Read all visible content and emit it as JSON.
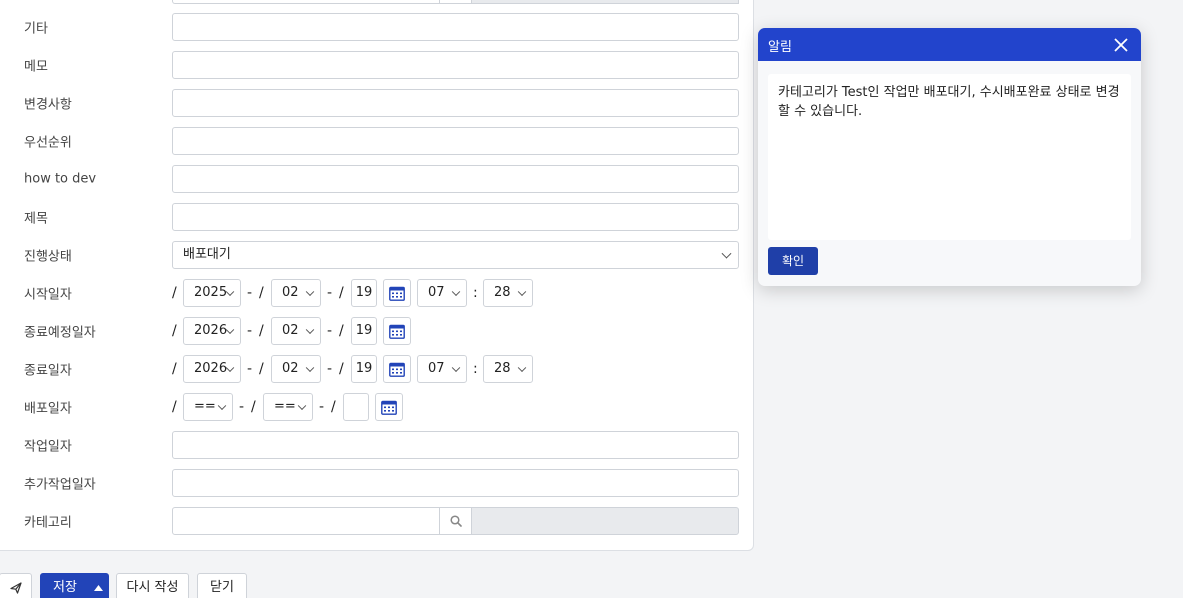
{
  "form": {
    "rows": [
      {
        "label": "기타"
      },
      {
        "label": "메모"
      },
      {
        "label": "변경사항"
      },
      {
        "label": "우선순위"
      },
      {
        "label": "how to dev"
      },
      {
        "label": "제목"
      }
    ],
    "status": {
      "label": "진행상태",
      "value": "배포대기"
    },
    "start_date": {
      "label": "시작일자",
      "year": "2025",
      "month": "02",
      "day": "19",
      "hour": "07",
      "minute": "28"
    },
    "planned_end_date": {
      "label": "종료예정일자",
      "year": "2026",
      "month": "02",
      "day": "19"
    },
    "end_date": {
      "label": "종료일자",
      "year": "2026",
      "month": "02",
      "day": "19",
      "hour": "07",
      "minute": "28"
    },
    "deploy_date": {
      "label": "배포일자",
      "year": "==",
      "month": "==",
      "day": ""
    },
    "work_date": {
      "label": "작업일자"
    },
    "extra_work_date": {
      "label": "추가작업일자"
    },
    "category": {
      "label": "카테고리"
    },
    "separators": {
      "slash": "/",
      "dash": "-",
      "colon": ":"
    }
  },
  "toolbar": {
    "save_label": "저장",
    "rewrite_label": "다시 작성",
    "close_label": "닫기"
  },
  "modal": {
    "title": "알림",
    "message": "카테고리가 Test인 작업만 배포대기, 수시배포완료 상태로 변경할 수 있습니다.",
    "ok_label": "확인"
  },
  "colors": {
    "primary": "#2244cc",
    "primary_dark": "#1f3fa8",
    "calendar_icon": "#2244b8"
  },
  "icons": {
    "calendar": "calendar-icon",
    "search": "search-icon",
    "close": "close-icon",
    "send": "send-icon",
    "caret_up": "caret-up-icon"
  }
}
